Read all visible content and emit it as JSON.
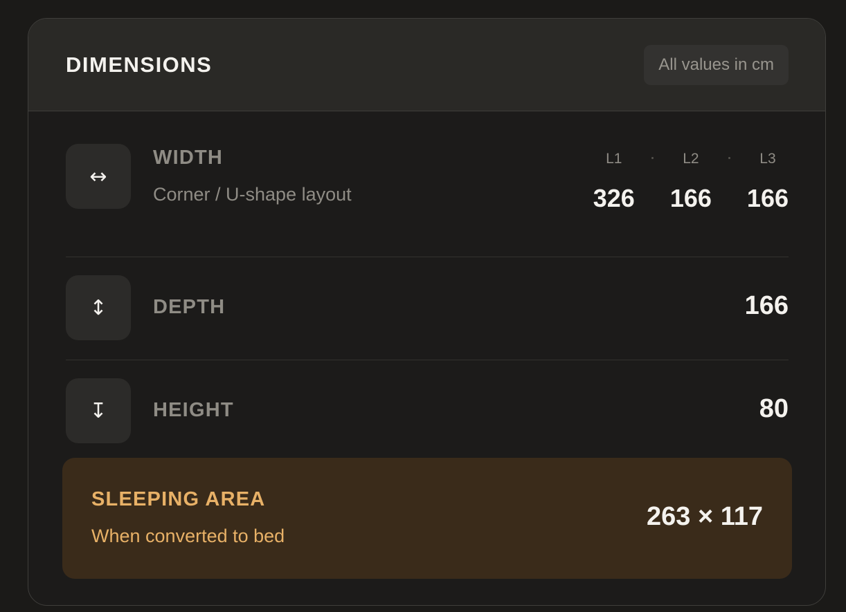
{
  "header": {
    "title": "DIMENSIONS",
    "units_badge": "All values in cm"
  },
  "rows": {
    "width": {
      "icon": "horizontal-arrows-icon",
      "label": "WIDTH",
      "subtitle": "Corner / U-shape layout",
      "segments": [
        {
          "label": "L1",
          "value": "326"
        },
        {
          "label": "L2",
          "value": "166"
        },
        {
          "label": "L3",
          "value": "166"
        }
      ]
    },
    "depth": {
      "icon": "vertical-arrows-icon",
      "label": "DEPTH",
      "value": "166"
    },
    "height": {
      "icon": "height-arrow-icon",
      "label": "HEIGHT",
      "value": "80"
    }
  },
  "sleeping_area": {
    "title": "SLEEPING AREA",
    "subtitle": "When converted to bed",
    "value": "263 × 117"
  },
  "colors": {
    "background": "#1b1a18",
    "card": "#1c1b1a",
    "header": "#2a2926",
    "accent": "#e8b167",
    "sleep_bg": "#3a2b1a",
    "text_primary": "#f4f2ee",
    "text_muted": "#8f8c85"
  }
}
